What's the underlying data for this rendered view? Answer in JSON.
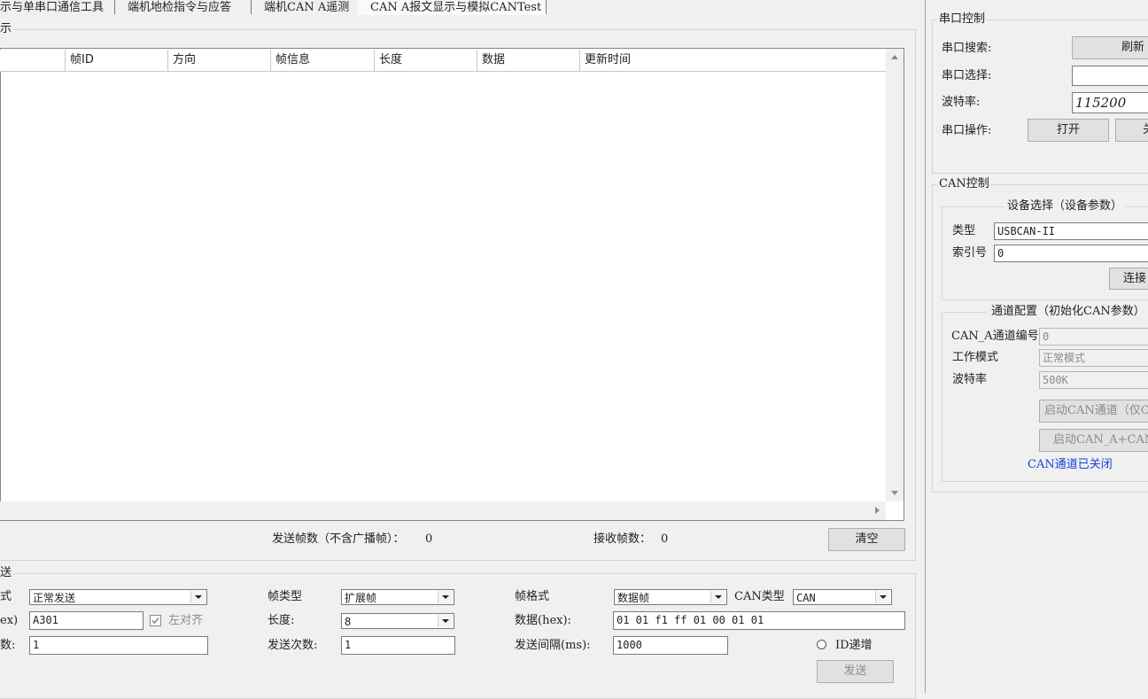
{
  "tabs": [
    {
      "label": "示与单串口通信工具"
    },
    {
      "label": "端机地检指令与应答"
    },
    {
      "label": "端机CAN A遥测"
    },
    {
      "label": "CAN A报文显示与模拟CANTest"
    }
  ],
  "display_group": {
    "title": "示",
    "columns": [
      "帧ID",
      "方向",
      "帧信息",
      "长度",
      "数据",
      "更新时间"
    ],
    "sent_frames_label": "发送帧数（不含广播帧）：",
    "sent_frames_value": "0",
    "recv_frames_label": "接收帧数：",
    "recv_frames_value": "0",
    "clear_label": "清空"
  },
  "send_group": {
    "title": "送",
    "send_mode_label": "式",
    "send_mode_value": "正常发送",
    "frame_type_label": "帧类型",
    "frame_type_value": "扩展帧",
    "frame_format_label": "帧格式",
    "frame_format_value": "数据帧",
    "can_type_label": "CAN类型",
    "can_type_value": "CAN",
    "id_label": "ex)",
    "id_value": "A301",
    "left_align_label": "左对齐",
    "length_label": "长度:",
    "length_value": "8",
    "data_label": "数据(hex):",
    "data_value": "01 01 f1 ff 01 00 01 01",
    "count_label": "数:",
    "count_value": "1",
    "send_times_label": "发送次数:",
    "send_times_value": "1",
    "interval_label": "发送间隔(ms):",
    "interval_value": "1000",
    "id_increment_label": "ID递增",
    "send_label": "发送"
  },
  "serial": {
    "title": "串口控制",
    "search_label": "串口搜索:",
    "refresh_label": "刷新",
    "select_label": "串口选择:",
    "select_value": "",
    "baud_label": "波特率:",
    "baud_value": "115200",
    "op_label": "串口操作:",
    "open_label": "打开",
    "close_label": "关"
  },
  "can": {
    "title": "CAN控制",
    "device_title": "设备选择（设备参数）",
    "type_label": "类型",
    "type_value": "USBCAN-II",
    "index_label": "索引号",
    "index_value": "0",
    "connect_label": "连接",
    "channel_title": "通道配置（初始化CAN参数）",
    "channel_no_label": "CAN_A通道编号",
    "channel_no_value": "0",
    "mode_label": "工作模式",
    "mode_value": "正常模式",
    "baud_label": "波特率",
    "baud_value": "500K",
    "start_a_label": "启动CAN通道（仅CA",
    "start_ab_label": "启动CAN_A+CAN_B",
    "status": "CAN通道已关闭",
    "status_color": "#1a3fd6"
  }
}
